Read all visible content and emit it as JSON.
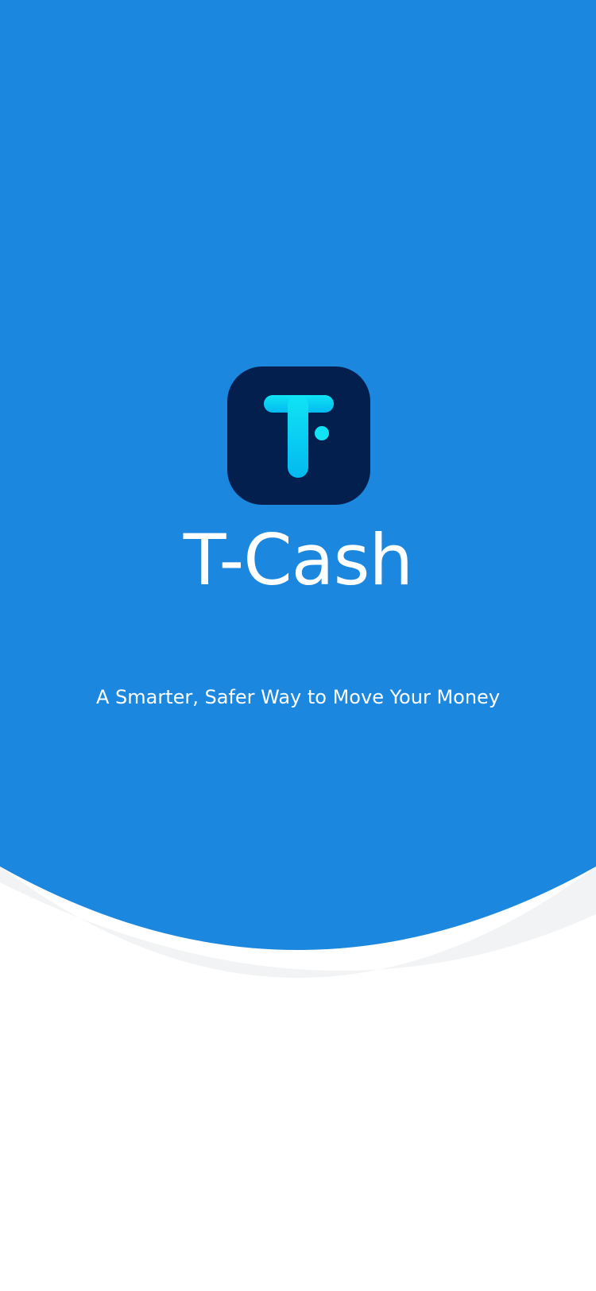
{
  "app": {
    "name": "T-Cash",
    "tagline": "A Smarter, Safer Way to Move Your Money"
  },
  "logo": {
    "icon": "t-cash-logo-icon",
    "letter": "T"
  },
  "colors": {
    "primary_blue": "#1C87DF",
    "shadow_gray": "#F2F3F4",
    "logo_background": "#031F4D",
    "logo_accent_top": "#10E4F4",
    "logo_accent_bottom": "#03B9F0",
    "text": "#FFFFFF",
    "page_background": "#FFFFFF"
  }
}
